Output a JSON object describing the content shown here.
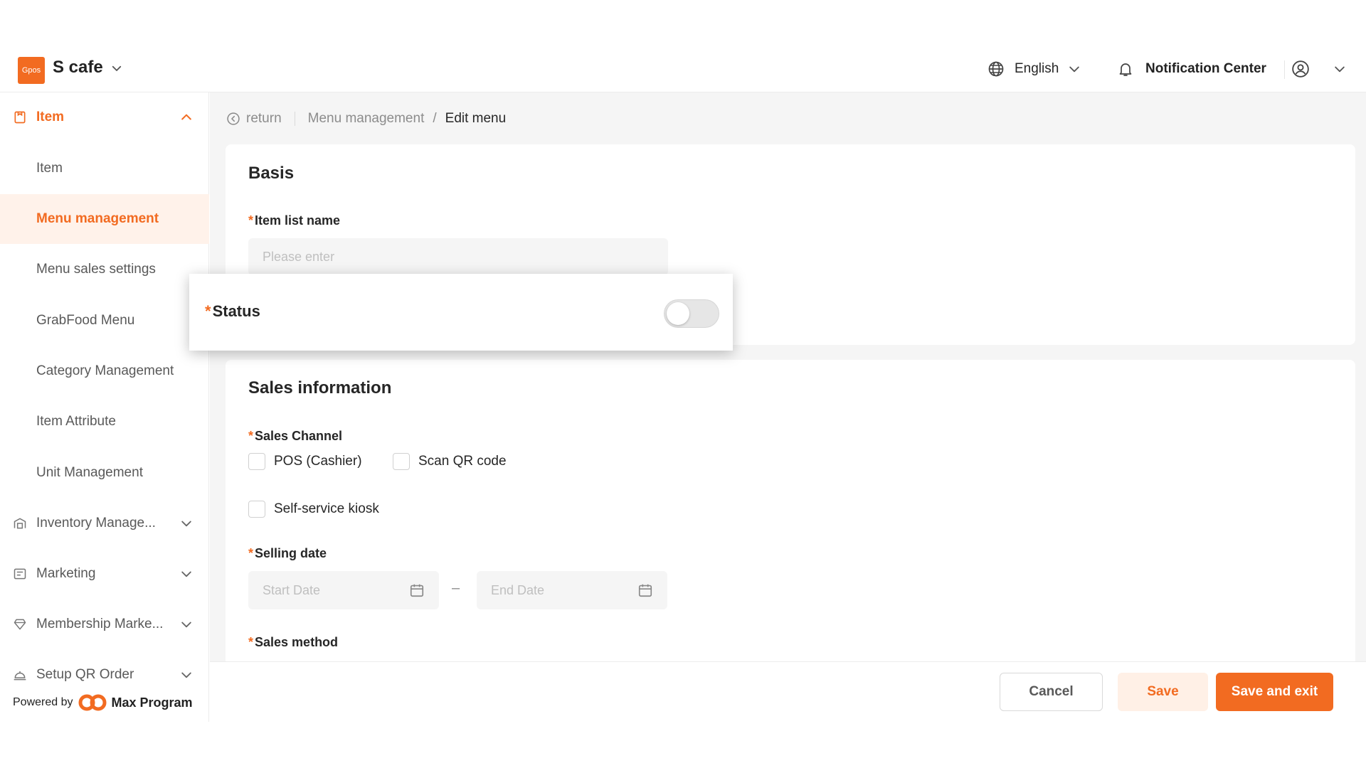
{
  "header": {
    "logo_text": "Gpos",
    "store_name": "S cafe",
    "language": "English",
    "notification": "Notification Center"
  },
  "sidebar": {
    "group_item": "Item",
    "items": [
      {
        "label": "Item"
      },
      {
        "label": "Menu management"
      },
      {
        "label": "Menu sales settings"
      },
      {
        "label": "GrabFood Menu"
      },
      {
        "label": "Category Management"
      },
      {
        "label": "Item Attribute"
      },
      {
        "label": "Unit Management"
      }
    ],
    "groups": [
      {
        "label": "Inventory Manage..."
      },
      {
        "label": "Marketing"
      },
      {
        "label": "Membership Marke..."
      },
      {
        "label": "Setup QR Order"
      }
    ],
    "powered_by": "Powered by",
    "brand": "Max Program"
  },
  "breadcrumb": {
    "return": "return",
    "parent": "Menu management",
    "separator": "/",
    "current": "Edit menu"
  },
  "basis": {
    "title": "Basis",
    "item_list_name_label": "Item list name",
    "item_list_name_placeholder": "Please enter",
    "status_label": "Status",
    "status_on": false
  },
  "sales": {
    "title": "Sales information",
    "channel_label": "Sales Channel",
    "channels": [
      {
        "label": "POS (Cashier)",
        "checked": false
      },
      {
        "label": "Scan QR code",
        "checked": false
      },
      {
        "label": "Self-service kiosk",
        "checked": false
      }
    ],
    "selling_date_label": "Selling date",
    "start_placeholder": "Start Date",
    "end_placeholder": "End Date",
    "range_sep": "–",
    "method_label": "Sales method"
  },
  "footer": {
    "cancel": "Cancel",
    "save": "Save",
    "save_exit": "Save and exit"
  },
  "colors": {
    "accent": "#f26b21",
    "accent_light": "#fff2ea"
  }
}
